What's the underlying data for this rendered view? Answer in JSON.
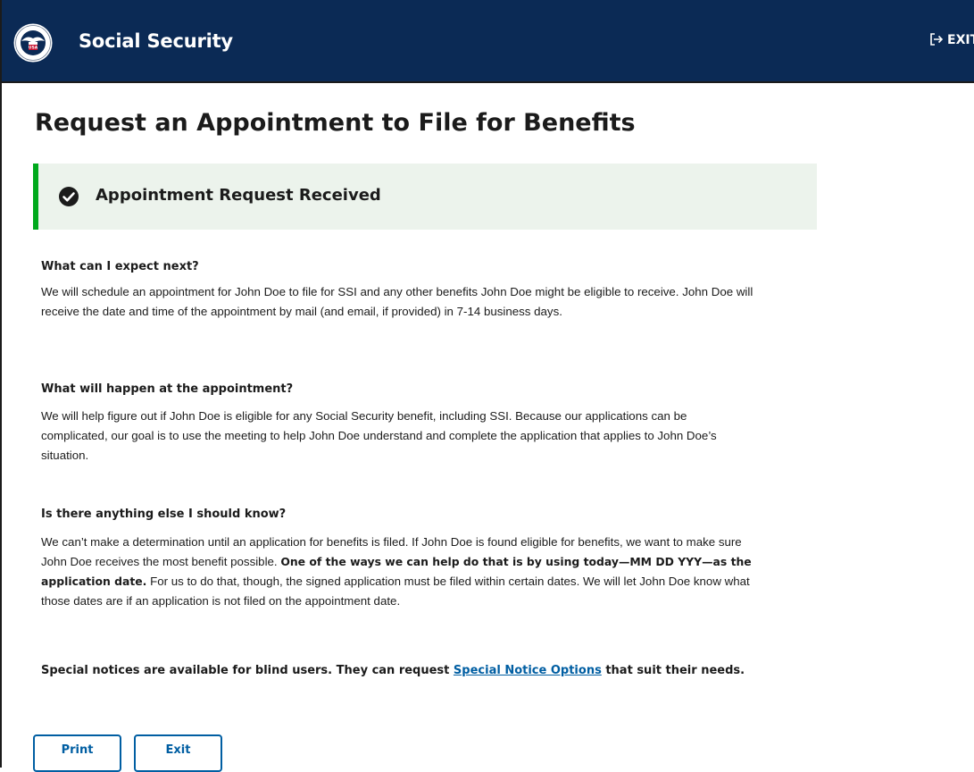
{
  "header": {
    "brand": "Social Security",
    "exit_label": "EXIT",
    "seal_text": "USA"
  },
  "page_title": "Request an Appointment to File for Benefits",
  "alert": {
    "title": "Appointment Request Received",
    "status_color": "#00a91c"
  },
  "sections": [
    {
      "heading": "What can I expect next?",
      "body": "We will schedule an appointment for John Doe to file for SSI and any other benefits John Doe might be eligible to receive. John Doe will receive the date and time of the appointment by mail (and email, if provided) in 7-14 business days."
    },
    {
      "heading": "What will happen at the appointment?",
      "body": "We will help figure out if John Doe is eligible for any Social Security benefit, including SSI. Because our applications can be complicated, our goal is to use the meeting to help John Doe understand and complete the application that applies to John Doe’s situation."
    },
    {
      "heading": "Is there anything else I should know?",
      "body_before": "We can’t make a determination until an application for benefits is filed. If John Doe is found eligible for benefits, we want to make sure John Doe receives the most benefit possible. ",
      "body_bold": "One of the ways we can help do that is by using today—MM DD YYY—as the application date.",
      "body_after": " For us to do that, though, the signed application must be filed within certain dates. We will let John Doe know what those dates are if an application is not filed on the appointment date."
    }
  ],
  "notice": {
    "before": "Special notices are available for blind users. They can request ",
    "link": "Special Notice Options",
    "after": " that suit their needs."
  },
  "buttons": {
    "print": "Print",
    "exit": "Exit"
  },
  "colors": {
    "header_bg": "#0b2a55",
    "alert_bg": "#ecf3ec",
    "link": "#005ea2"
  }
}
